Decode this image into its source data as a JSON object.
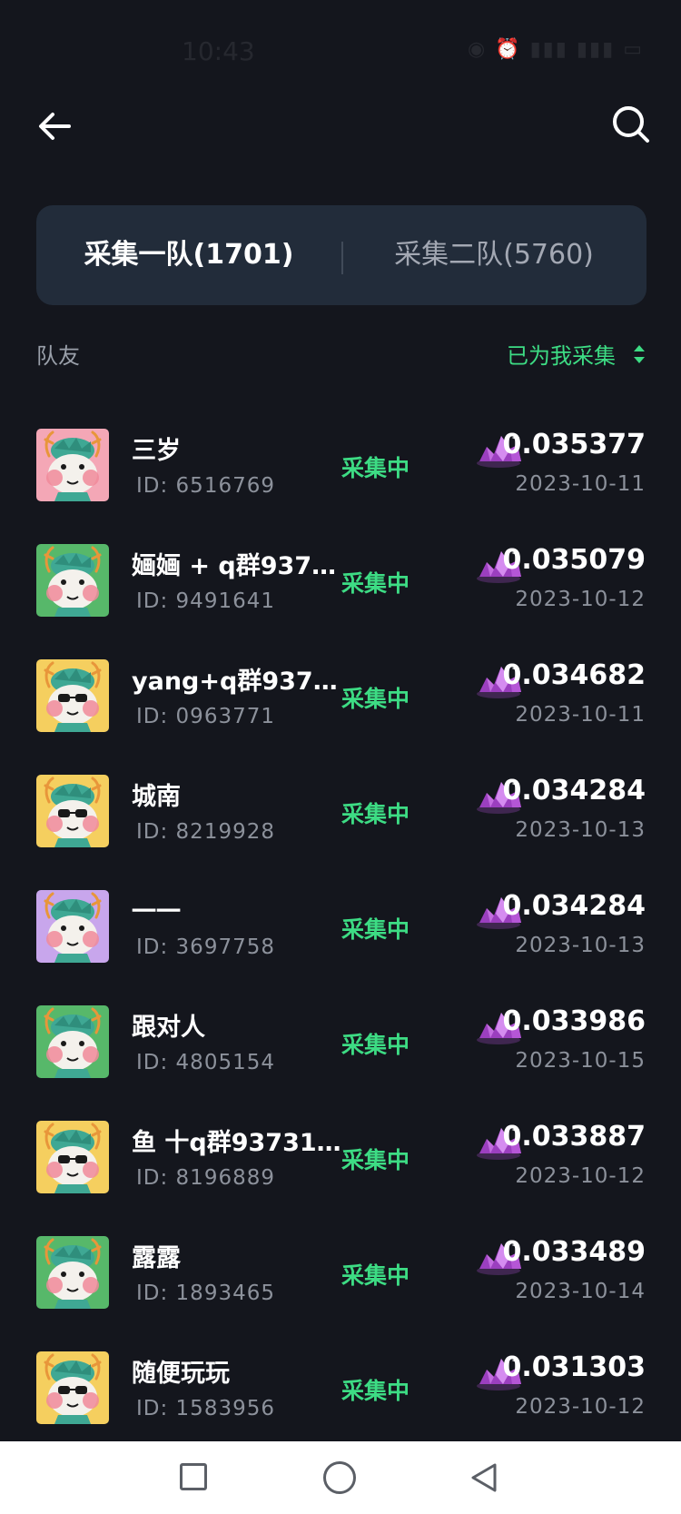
{
  "status_bar": {
    "time": "10:43",
    "icons_text": "◉ ⏰ ▮▮▮ ▮▮▮ ▭"
  },
  "nav": {
    "back_icon": "arrow-left-icon",
    "search_icon": "search-icon"
  },
  "tabs": [
    {
      "label": "采集一队(1701)",
      "active": true
    },
    {
      "label": "采集二队(5760)",
      "active": false
    }
  ],
  "list_header": {
    "left_label": "队友",
    "sort_label": "已为我采集"
  },
  "colors": {
    "accent": "#3ddc84",
    "background": "#14161d",
    "tab_bg": "#222c3a"
  },
  "members": [
    {
      "name": "三岁",
      "id": "ID:  6516769",
      "status": "采集中",
      "amount": "0.035377",
      "date": "2023-10-11",
      "avatar_bg": "#f4a7b6",
      "glasses": false
    },
    {
      "name": "婳婳 + q群9373...",
      "id": "ID:  9491641",
      "status": "采集中",
      "amount": "0.035079",
      "date": "2023-10-12",
      "avatar_bg": "#57b86a",
      "glasses": false
    },
    {
      "name": "yang+q群93731...",
      "id": "ID:  0963771",
      "status": "采集中",
      "amount": "0.034682",
      "date": "2023-10-11",
      "avatar_bg": "#f5cf5f",
      "glasses": true
    },
    {
      "name": "城南",
      "id": "ID:  8219928",
      "status": "采集中",
      "amount": "0.034284",
      "date": "2023-10-13",
      "avatar_bg": "#f5cf5f",
      "glasses": true
    },
    {
      "name": "一一",
      "id": "ID:  3697758",
      "status": "采集中",
      "amount": "0.034284",
      "date": "2023-10-13",
      "avatar_bg": "#c8a6ec",
      "glasses": false
    },
    {
      "name": "跟对人",
      "id": "ID:  4805154",
      "status": "采集中",
      "amount": "0.033986",
      "date": "2023-10-15",
      "avatar_bg": "#57b86a",
      "glasses": false
    },
    {
      "name": "鱼 十q群937314...",
      "id": "ID:  8196889",
      "status": "采集中",
      "amount": "0.033887",
      "date": "2023-10-12",
      "avatar_bg": "#f5cf5f",
      "glasses": true
    },
    {
      "name": "露露",
      "id": "ID:  1893465",
      "status": "采集中",
      "amount": "0.033489",
      "date": "2023-10-14",
      "avatar_bg": "#57b86a",
      "glasses": false
    },
    {
      "name": "随便玩玩",
      "id": "ID:  1583956",
      "status": "采集中",
      "amount": "0.031303",
      "date": "2023-10-12",
      "avatar_bg": "#f5cf5f",
      "glasses": true
    }
  ],
  "system_nav": {
    "recents_icon": "square-icon",
    "home_icon": "circle-icon",
    "back_icon": "triangle-back-icon"
  }
}
